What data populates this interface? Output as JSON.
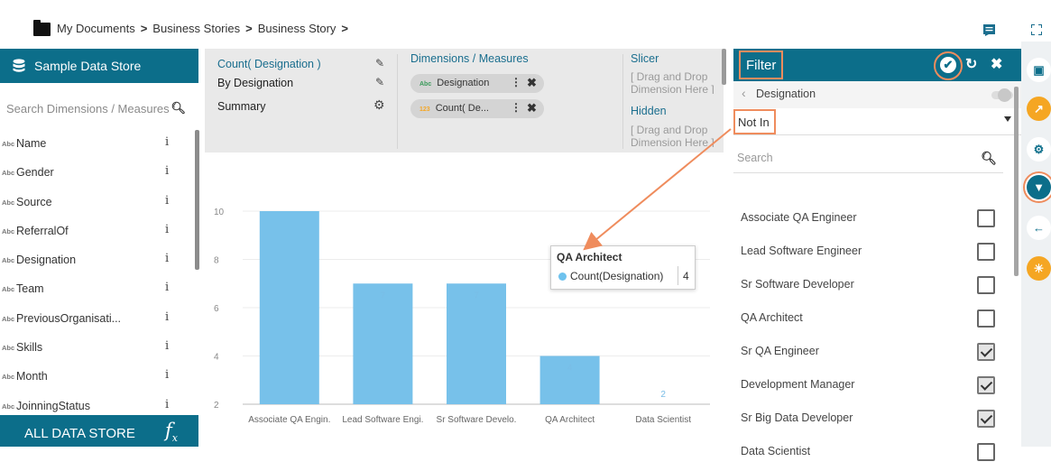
{
  "breadcrumb": {
    "items": [
      "My Documents",
      "Business Stories",
      "Business Story"
    ],
    "separator": ">"
  },
  "top_icons": {
    "comment": "comment-icon",
    "fullscreen": "fullscreen-icon"
  },
  "datastore": {
    "title": "Sample Data Store",
    "search_placeholder": "Search Dimensions / Measures",
    "type_label": "Abc",
    "fields": [
      "Name",
      "Gender",
      "Source",
      "ReferralOf",
      "Designation",
      "Team",
      "PreviousOrganisati...",
      "Skills",
      "Month",
      "JoinningStatus"
    ],
    "info_glyph": "i",
    "footer": "ALL DATA STORE",
    "fx": "f",
    "fx_sub": "x"
  },
  "config": {
    "chart_lines": [
      "Count( Designation )",
      "By Designation",
      "Summary"
    ],
    "dimensions_title": "Dimensions / Measures",
    "pills": [
      {
        "type": "Abc",
        "label": "Designation"
      },
      {
        "type": "123",
        "label": "Count( De..."
      }
    ],
    "slicer_title": "Slicer",
    "slicer_hint": [
      "[ Drag and Drop",
      "Dimension Here ]"
    ],
    "hidden_title": "Hidden",
    "hidden_hint": [
      "[ Drag and Drop",
      "Dimension Here ]"
    ]
  },
  "chart_data": {
    "type": "bar",
    "categories": [
      "Associate QA Engin.",
      "Lead Software Engi.",
      "Sr Software Develo.",
      "QA Architect",
      "Data Scientist"
    ],
    "values": [
      10,
      7,
      7,
      4,
      2
    ],
    "data_labels": [
      "",
      "7",
      "7",
      "4",
      "2"
    ],
    "ylim": [
      2,
      10
    ],
    "yticks": [
      2,
      4,
      6,
      8,
      10
    ],
    "bar_color": "#77c1ea",
    "grid": true
  },
  "tooltip": {
    "title": "QA Architect",
    "series": "Count(Designation)",
    "value": "4",
    "dot_color": "#6ec2ee"
  },
  "filter": {
    "title": "Filter",
    "dimension": "Designation",
    "operator": "Not In",
    "search_placeholder": "Search",
    "items": [
      {
        "label": "Associate QA Engineer",
        "checked": false
      },
      {
        "label": "Lead Software Engineer",
        "checked": false
      },
      {
        "label": "Sr Software Developer",
        "checked": false
      },
      {
        "label": "QA Architect",
        "checked": false
      },
      {
        "label": "Sr QA Engineer",
        "checked": true
      },
      {
        "label": "Development Manager",
        "checked": true
      },
      {
        "label": "Sr Big Data Developer",
        "checked": true
      },
      {
        "label": "Data Scientist",
        "checked": false
      }
    ]
  },
  "rail": {
    "buttons": [
      {
        "icon": "save-icon",
        "bg": "#ffffff",
        "fg": "#0c6e8a",
        "glyph": "▣"
      },
      {
        "icon": "chart-trend-icon",
        "bg": "#f5a623",
        "fg": "#ffffff",
        "glyph": "↗"
      },
      {
        "icon": "settings-icon",
        "bg": "#ffffff",
        "fg": "#0c6e8a",
        "glyph": "⚙"
      },
      {
        "icon": "filter-icon",
        "bg": "#0c6e8a",
        "fg": "#ffffff",
        "glyph": "▼"
      },
      {
        "icon": "back-arrow-icon",
        "bg": "#ffffff",
        "fg": "#0c6e8a",
        "glyph": "←"
      },
      {
        "icon": "bulb-icon",
        "bg": "#f5a623",
        "fg": "#ffffff",
        "glyph": "☀"
      }
    ]
  },
  "colors": {
    "primary": "#0c6e8a",
    "highlight": "#ef8c5d",
    "bar": "#77c1ea",
    "orange": "#f5a623"
  }
}
